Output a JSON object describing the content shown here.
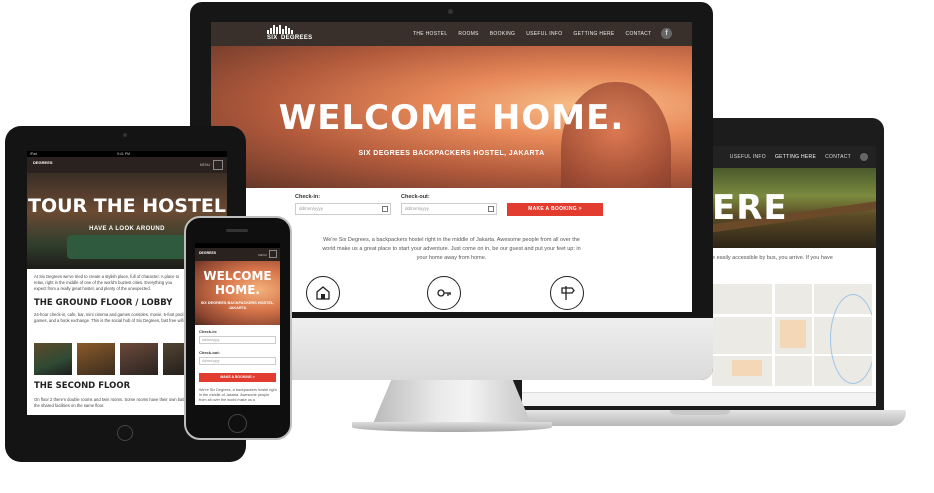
{
  "brand": {
    "logo_line1": "SIX",
    "logo_line2": "DEGREES"
  },
  "desktop": {
    "nav": [
      "THE HOSTEL",
      "ROOMS",
      "BOOKING",
      "USEFUL INFO",
      "GETTING HERE",
      "CONTACT"
    ],
    "fb_glyph": "f",
    "hero_title": "WELCOME HOME.",
    "hero_subtitle": "SIX DEGREES BACKPACKERS HOSTEL, JAKARTA",
    "checkin_label": "Check-in:",
    "checkout_label": "Check-out:",
    "date_placeholder": "dd/mm/yyyy",
    "booking_button": "MAKE A BOOKING  >",
    "intro_text": "We're Six Degrees, a backpackers hostel right in the middle of Jakarta. Awesome people from all over the world make us a great place to start your adventure. Just come on in, be our guest and put your feet up: in your home away from home.",
    "feature_icons": [
      "welcome-sign-icon",
      "key-tag-icon",
      "direction-sign-icon"
    ]
  },
  "laptop": {
    "nav": [
      "USEFUL INFO",
      "GETTING HERE",
      "CONTACT"
    ],
    "hero_title": "ERE",
    "body_text": "e easily accessible by bus, you arrive. If you have"
  },
  "tablet": {
    "status_left": "iPad",
    "status_time": "9:41 PM",
    "menu_label": "MENU",
    "hero_title": "TOUR THE HOSTEL",
    "hero_subtitle": "HAVE A LOOK AROUND",
    "intro_text": "At Six Degrees we've tried to create a stylish place, full of character. A place to relax, right in the middle of one of the world's buziest cities. Everything you expect from a really great hostel, and plenty of the unexpected.",
    "section1_title": "THE GROUND FLOOR / LOBBY",
    "section1_text": "24-hour check-in, cafe, bar, mini cinema and games consoles, movie, 5-foot pool board and other games, and a book exchange. This is the social hub of Six Degrees, fast free wifi too.",
    "section2_title": "THE SECOND FLOOR",
    "section2_text": "On floor 2 there's double rooms and twin rooms. Some rooms have their own bathroom, others use the shared facilities on the same floor."
  },
  "phone": {
    "menu_label": "MENU",
    "hero_title_line1": "WELCOME",
    "hero_title_line2": "HOME.",
    "hero_subtitle_line1": "SIX DEGREES BACKPACKERS HOSTEL,",
    "hero_subtitle_line2": "JAKARTA",
    "checkin_label": "Check-in:",
    "checkout_label": "Check-out:",
    "date_placeholder": "dd/mm/yyyy",
    "booking_button": "MAKE A BOOKING  >",
    "intro_text": "We're Six Degrees, a backpackers hostel right in the middle of Jakarta. Awesome people from all over the world make us a"
  },
  "colors": {
    "accent": "#e23c30",
    "nav_dark": "#2a221e"
  }
}
